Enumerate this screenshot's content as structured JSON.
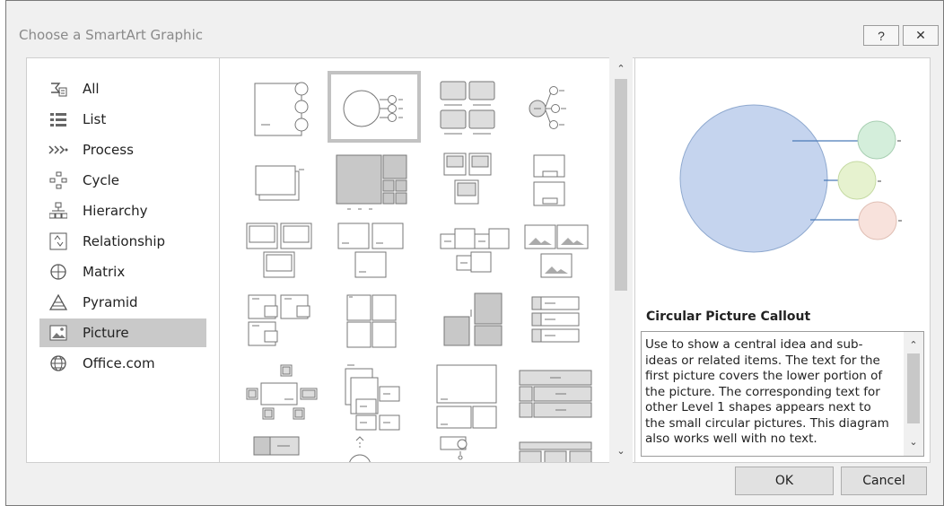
{
  "dialog": {
    "title": "Choose a SmartArt Graphic",
    "help_glyph": "?",
    "close_glyph": "✕"
  },
  "categories": [
    {
      "label": "All",
      "icon": "all-icon"
    },
    {
      "label": "List",
      "icon": "list-icon"
    },
    {
      "label": "Process",
      "icon": "process-icon"
    },
    {
      "label": "Cycle",
      "icon": "cycle-icon"
    },
    {
      "label": "Hierarchy",
      "icon": "hierarchy-icon"
    },
    {
      "label": "Relationship",
      "icon": "relationship-icon"
    },
    {
      "label": "Matrix",
      "icon": "matrix-icon"
    },
    {
      "label": "Pyramid",
      "icon": "pyramid-icon"
    },
    {
      "label": "Picture",
      "icon": "picture-icon",
      "selected": true
    },
    {
      "label": "Office.com",
      "icon": "globe-icon"
    }
  ],
  "preview": {
    "title": "Circular Picture Callout",
    "description": "Use to show a central idea and sub-ideas or related items. The text for the first picture covers the lower portion of the picture. The corresponding text for other Level 1 shapes appears next to the small circular pictures. This diagram also works well with no text.",
    "colors": {
      "main": "#c5d4ee",
      "green": "#d4eedb",
      "lime": "#e6f2cf",
      "pink": "#f8e2dc",
      "line": "#4a7ab8"
    }
  },
  "buttons": {
    "ok": "OK",
    "cancel": "Cancel"
  },
  "scroll": {
    "up": "⌃",
    "down": "⌄"
  }
}
